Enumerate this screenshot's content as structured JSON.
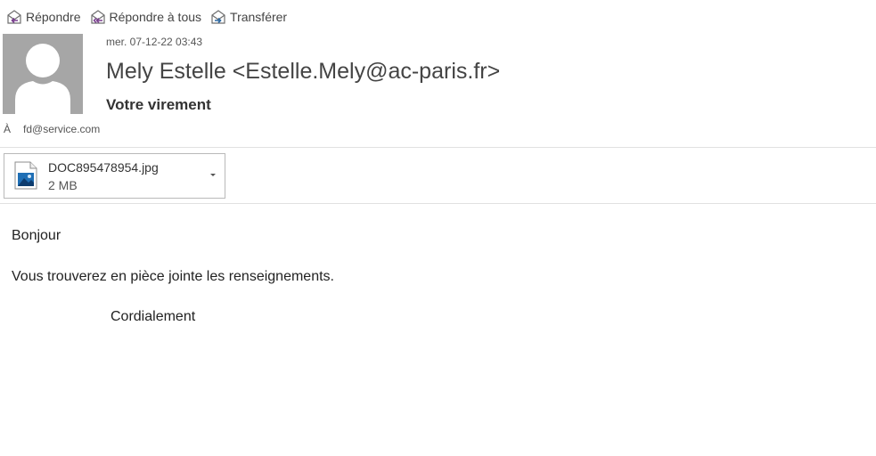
{
  "toolbar": {
    "reply_label": "Répondre",
    "reply_all_label": "Répondre à tous",
    "forward_label": "Transférer"
  },
  "message": {
    "date": "mer. 07-12-22 03:43",
    "sender": "Mely Estelle <Estelle.Mely@ac-paris.fr>",
    "subject": "Votre virement",
    "to_label": "À",
    "to_address": "fd@service.com"
  },
  "attachment": {
    "filename": "DOC895478954.jpg",
    "size": "2 MB",
    "icon": "image-file-icon"
  },
  "body": {
    "greeting": "Bonjour",
    "line1": "Vous trouverez en pièce jointe les renseignements.",
    "closing": "Cordialement"
  },
  "colors": {
    "avatar_bg": "#a6a6a6",
    "reply_arrow": "#7a3f8f",
    "forward_arrow": "#2f6aa3",
    "divider": "#e1e1e1"
  }
}
